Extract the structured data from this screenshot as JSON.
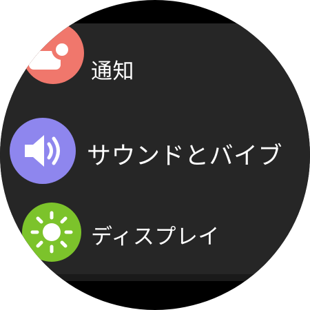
{
  "menu": {
    "items": [
      {
        "label": "通知",
        "icon": "notification-icon",
        "color": "#f0776c"
      },
      {
        "label": "サウンドとバイブ",
        "icon": "volume-icon",
        "color": "#8e86ee"
      },
      {
        "label": "ディスプレイ",
        "icon": "brightness-icon",
        "color": "#7cc32b"
      }
    ]
  }
}
